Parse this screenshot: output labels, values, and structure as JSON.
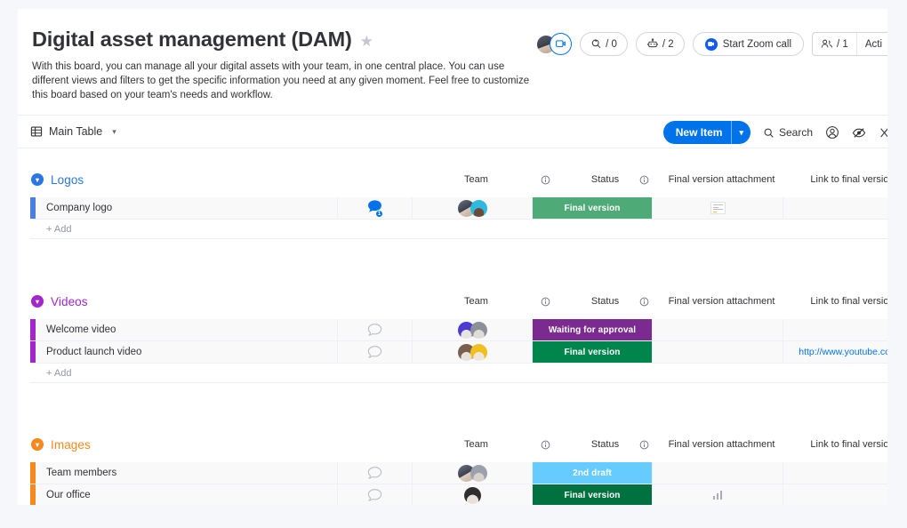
{
  "header": {
    "title": "Digital asset management (DAM)",
    "star_icon": "star-icon",
    "description": "With this board, you can manage all your digital assets with your team, in one central place. You can use different views and filters to get the specific information you need at any given moment. Feel free to customize this board based on your team's needs and workflow.",
    "updates_count": "/ 0",
    "automations_count": "/ 2",
    "zoom_button": "Start Zoom call",
    "members_count": "/ 1",
    "activity_label": "Acti"
  },
  "toolbar": {
    "view_name": "Main Table",
    "new_item": "New Item",
    "search": "Search",
    "person_icon": "person-icon",
    "hide_icon": "hide-eye-icon",
    "more_icon": "more-icon"
  },
  "columns": {
    "team": "Team",
    "status": "Status",
    "attachment": "Final version attachment",
    "link": "Link to final version",
    "add_label": "+ Add"
  },
  "groups": [
    {
      "name": "Logos",
      "color": "#2b76e5",
      "stripe": "#4a7fe0",
      "rows": [
        {
          "name": "Company logo",
          "comment": "1",
          "comment_active": true,
          "avatars": [
            "#4a4e5c",
            "#2fb8e0"
          ],
          "status": {
            "label": "Final version",
            "color": "#4eab78"
          },
          "attachment": "image-thumbnail",
          "link": ""
        }
      ]
    },
    {
      "name": "Videos",
      "color": "#a226c9",
      "stripe": "#a226c9",
      "rows": [
        {
          "name": "Welcome video",
          "comment": "",
          "comment_active": false,
          "avatars": [
            "#4e3ad1",
            "#8d8f99"
          ],
          "status": {
            "label": "Waiting for approval",
            "color": "#7b2a8f"
          },
          "attachment": "",
          "link": ""
        },
        {
          "name": "Product launch video",
          "comment": "",
          "comment_active": false,
          "avatars": [
            "#7a5f4e",
            "#f0c020"
          ],
          "status": {
            "label": "Final version",
            "color": "#00854d"
          },
          "attachment": "",
          "link": "http://www.youtube.com"
        }
      ]
    },
    {
      "name": "Images",
      "color": "#f5891f",
      "stripe": "#f5891f",
      "rows": [
        {
          "name": "Team members",
          "comment": "",
          "comment_active": false,
          "avatars": [
            "#555a66",
            "#9aa0ad"
          ],
          "status": {
            "label": "2nd draft",
            "color": "#66ccff"
          },
          "attachment": "",
          "link": ""
        },
        {
          "name": "Our office",
          "comment": "",
          "comment_active": false,
          "avatars": [
            "#3a3a3a"
          ],
          "status": {
            "label": "Final version",
            "color": "#00713f"
          },
          "attachment": "bar-chart-thumbnail",
          "link": ""
        }
      ]
    }
  ]
}
